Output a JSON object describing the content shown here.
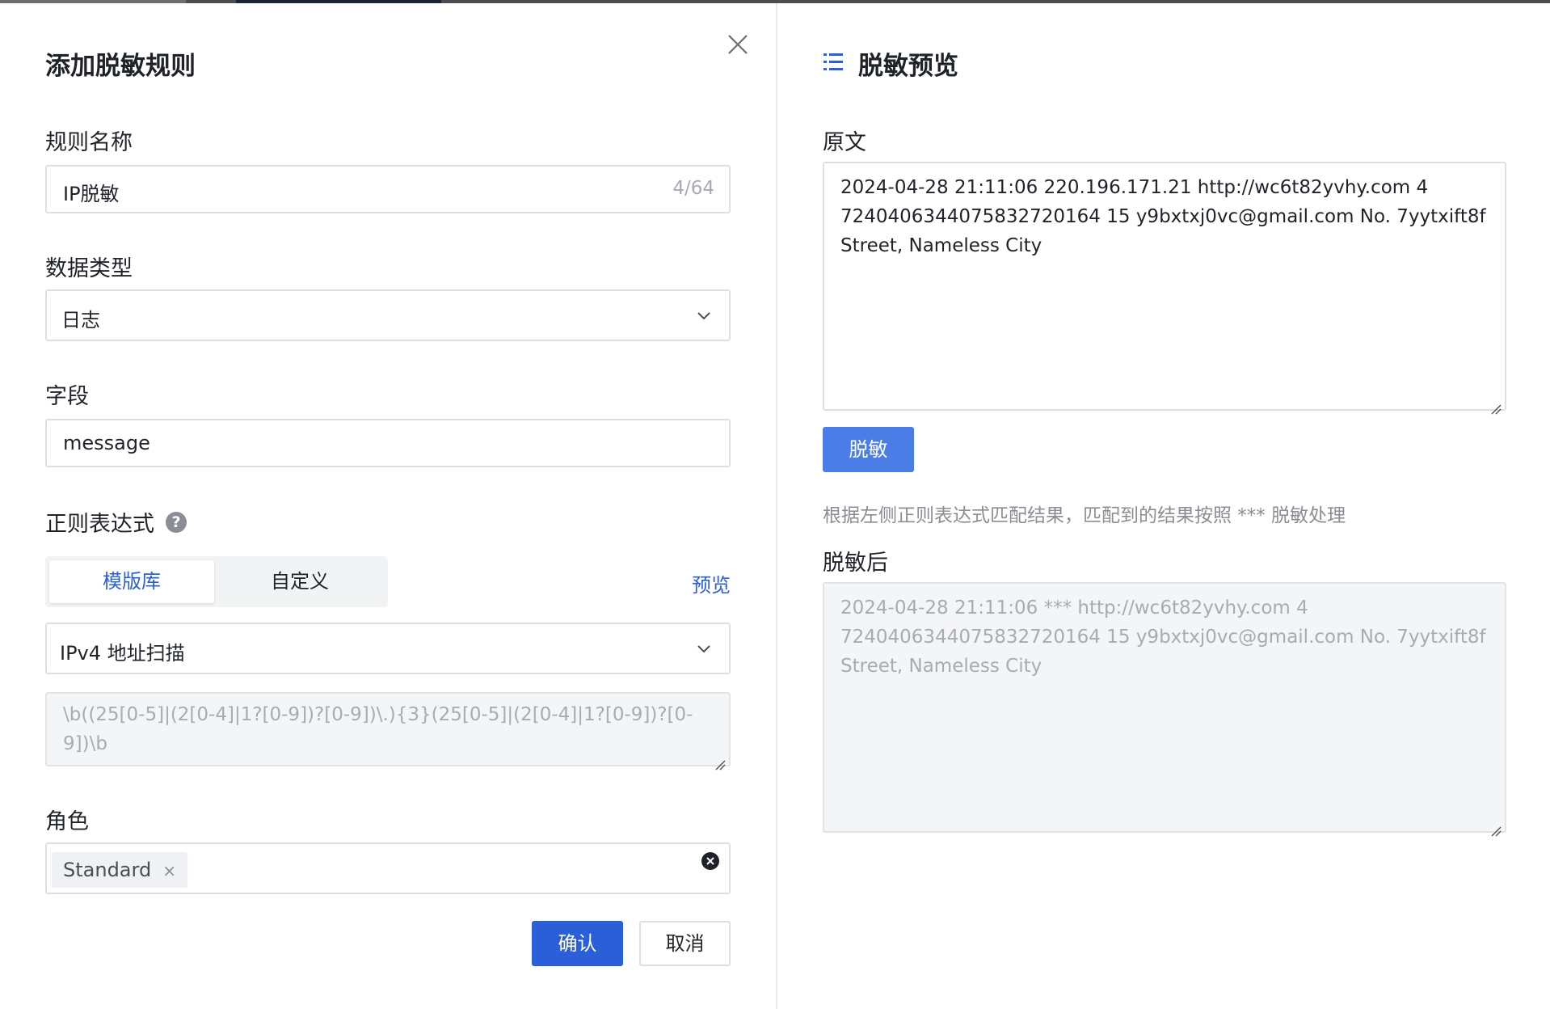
{
  "dialog": {
    "title": "添加脱敏规则",
    "fields": {
      "rule_name": {
        "label": "规则名称",
        "value": "IP脱敏",
        "counter": "4/64"
      },
      "data_type": {
        "label": "数据类型",
        "value": "日志"
      },
      "field": {
        "label": "字段",
        "value": "message"
      },
      "regex": {
        "label": "正则表达式",
        "tabs": [
          {
            "label": "模版库",
            "active": true
          },
          {
            "label": "自定义",
            "active": false
          }
        ],
        "preview_link": "预览",
        "template_value": "IPv4 地址扫描",
        "expression": "\\b((25[0-5]|(2[0-4]|1?[0-9])?[0-9])\\.){3}(25[0-5]|(2[0-4]|1?[0-9])?[0-9])\\b"
      },
      "role": {
        "label": "角色",
        "tags": [
          "Standard"
        ]
      }
    },
    "buttons": {
      "confirm": "确认",
      "cancel": "取消"
    }
  },
  "preview": {
    "title": "脱敏预览",
    "original_label": "原文",
    "original_text": "2024-04-28 21:11:06 220.196.171.21 http://wc6t82yvhy.com 4 7240406344075832720164 15 y9bxtxj0vc@gmail.com No. 7yytxift8f Street, Nameless City",
    "mask_button": "脱敏",
    "hint": "根据左侧正则表达式匹配结果，匹配到的结果按照 *** 脱敏处理",
    "after_label": "脱敏后",
    "after_text": "2024-04-28 21:11:06 *** http://wc6t82yvhy.com 4 7240406344075832720164 15 y9bxtxj0vc@gmail.com No. 7yytxift8f Street, Nameless City"
  },
  "colors": {
    "primary": "#2b5fd9",
    "mask_button": "#4a7ee6",
    "border": "#dcdfe6"
  }
}
